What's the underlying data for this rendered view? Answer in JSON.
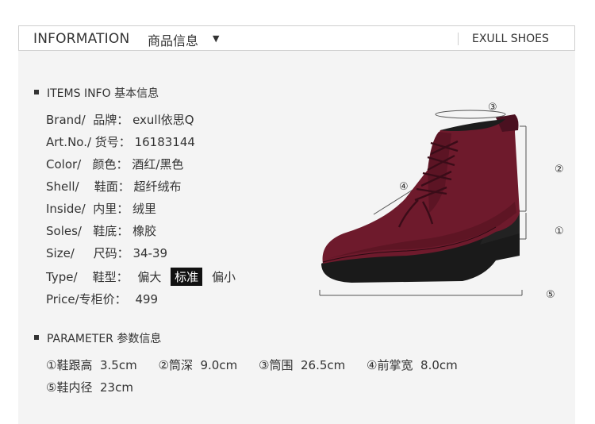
{
  "header": {
    "title": "INFORMATION",
    "title_cn": "商品信息",
    "dropdown_arrow": "▼",
    "brand": "EXULL SHOES"
  },
  "items_info": {
    "heading": "ITEMS INFO 基本信息",
    "rows": [
      {
        "label": "Brand/  品牌：",
        "value": "exull依思Q"
      },
      {
        "label": "Art.No./ 货号：",
        "value": "16183144"
      },
      {
        "label": "Color/   颜色：",
        "value": "酒红/黑色"
      },
      {
        "label": "Shell/    鞋面：",
        "value": "超纤绒布"
      },
      {
        "label": "Inside/  内里：",
        "value": "绒里"
      },
      {
        "label": "Soles/   鞋底：",
        "value": "橡胶"
      },
      {
        "label": "Size/     尺码：",
        "value": "34-39"
      }
    ],
    "type": {
      "label": "Type/    鞋型：",
      "options": [
        "偏大",
        "标准",
        "偏小"
      ],
      "selected": "标准"
    },
    "price": {
      "label": "Price/专柜价：",
      "value": "499"
    }
  },
  "parameter": {
    "heading": "PARAMETER 参数信息",
    "items": [
      {
        "name": "①鞋跟高",
        "value": "3.5cm"
      },
      {
        "name": "②筒深",
        "value": "9.0cm"
      },
      {
        "name": "③筒围",
        "value": "26.5cm"
      },
      {
        "name": "④前掌宽",
        "value": "8.0cm"
      },
      {
        "name": "⑤鞋内径",
        "value": "23cm"
      }
    ]
  },
  "diagram": {
    "labels": [
      "③",
      "②",
      "④",
      "①",
      "⑤"
    ]
  },
  "colors": {
    "suede": "#6e1a2c",
    "sole": "#1a1a1a",
    "panel_bg": "#f4f4f4",
    "border": "#cfcfcf"
  }
}
